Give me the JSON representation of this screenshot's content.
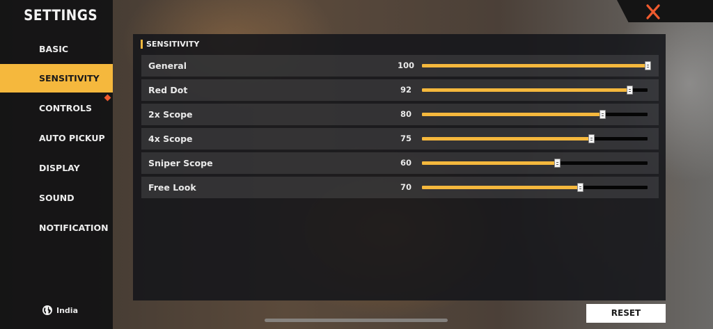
{
  "sidebar": {
    "title": "SETTINGS",
    "items": [
      {
        "label": "BASIC",
        "active": false
      },
      {
        "label": "SENSITIVITY",
        "active": true
      },
      {
        "label": "CONTROLS",
        "active": false
      },
      {
        "label": "AUTO PICKUP",
        "active": false
      },
      {
        "label": "DISPLAY",
        "active": false
      },
      {
        "label": "SOUND",
        "active": false
      },
      {
        "label": "NOTIFICATION",
        "active": false
      }
    ],
    "region": "India"
  },
  "section": {
    "title": "SENSITIVITY"
  },
  "sliders": [
    {
      "label": "General",
      "value": 100
    },
    {
      "label": "Red Dot",
      "value": 92
    },
    {
      "label": "2x Scope",
      "value": 80
    },
    {
      "label": "4x Scope",
      "value": 75
    },
    {
      "label": "Sniper Scope",
      "value": 60
    },
    {
      "label": "Free Look",
      "value": 70
    }
  ],
  "slider_max": 100,
  "buttons": {
    "reset": "RESET"
  },
  "colors": {
    "accent": "#f5b83d",
    "close": "#ef5a2e",
    "marker": "#ef5a2e"
  },
  "icons": {
    "close": "close-icon",
    "region": "globe-icon"
  }
}
